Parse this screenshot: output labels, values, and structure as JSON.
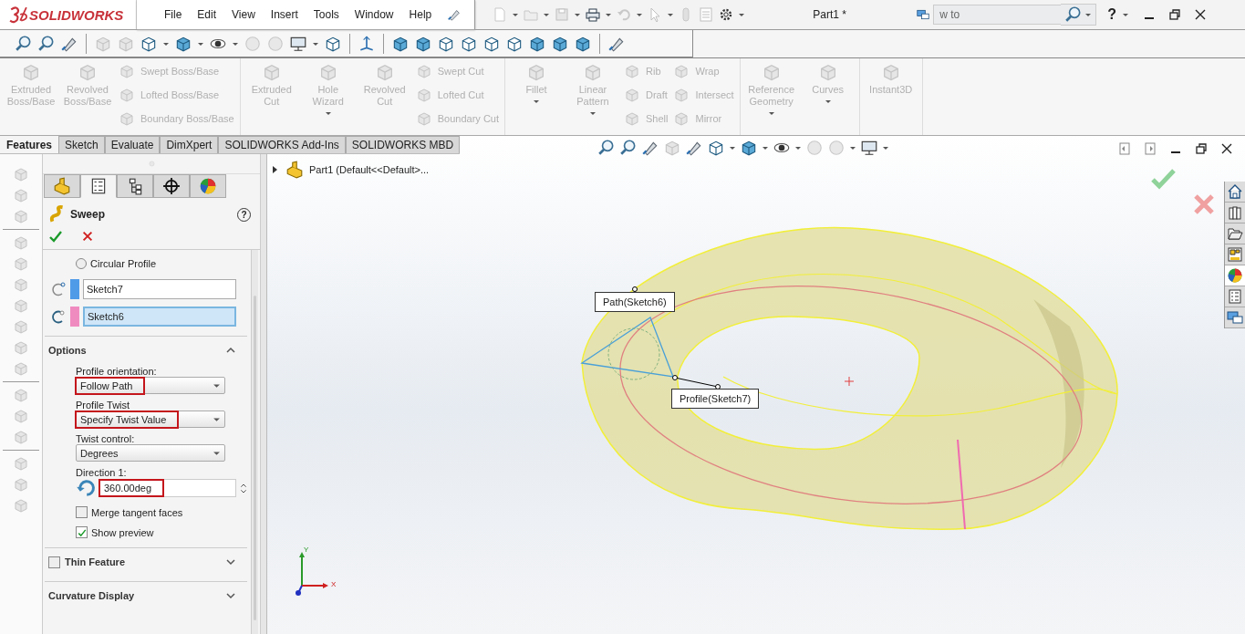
{
  "title_bar": {
    "logo": "SOLIDWORKS",
    "menu": [
      "File",
      "Edit",
      "View",
      "Insert",
      "Tools",
      "Window",
      "Help"
    ],
    "document_title": "Part1 *",
    "search": {
      "placeholder": "w to"
    },
    "help": "?"
  },
  "command_manager": {
    "groups": [
      {
        "columns": [
          {
            "kind": "large",
            "label": "Extruded Boss/Base",
            "disabled": true,
            "dropdown": false
          },
          {
            "kind": "large",
            "label": "Revolved Boss/Base",
            "disabled": true,
            "dropdown": false
          },
          {
            "kind": "stack",
            "items": [
              {
                "label": "Swept Boss/Base",
                "disabled": true
              },
              {
                "label": "Lofted Boss/Base",
                "disabled": true
              },
              {
                "label": "Boundary Boss/Base",
                "disabled": true
              }
            ]
          }
        ]
      },
      {
        "columns": [
          {
            "kind": "large",
            "label": "Extruded Cut",
            "disabled": true,
            "dropdown": false
          },
          {
            "kind": "large",
            "label": "Hole Wizard",
            "disabled": true,
            "dropdown": true
          },
          {
            "kind": "large",
            "label": "Revolved Cut",
            "disabled": true,
            "dropdown": false
          },
          {
            "kind": "stack",
            "items": [
              {
                "label": "Swept Cut",
                "disabled": true
              },
              {
                "label": "Lofted Cut",
                "disabled": true
              },
              {
                "label": "Boundary Cut",
                "disabled": true
              }
            ]
          }
        ]
      },
      {
        "columns": [
          {
            "kind": "large",
            "label": "Fillet",
            "disabled": true,
            "dropdown": true
          },
          {
            "kind": "large",
            "label": "Linear Pattern",
            "disabled": true,
            "dropdown": true
          },
          {
            "kind": "stack",
            "items": [
              {
                "label": "Rib",
                "disabled": true
              },
              {
                "label": "Draft",
                "disabled": true
              },
              {
                "label": "Shell",
                "disabled": true
              }
            ]
          },
          {
            "kind": "stack",
            "items": [
              {
                "label": "Wrap",
                "disabled": true
              },
              {
                "label": "Intersect",
                "disabled": true
              },
              {
                "label": "Mirror",
                "disabled": true
              }
            ]
          }
        ]
      },
      {
        "columns": [
          {
            "kind": "large",
            "label": "Reference Geometry",
            "disabled": true,
            "dropdown": true
          },
          {
            "kind": "large",
            "label": "Curves",
            "disabled": true,
            "dropdown": true
          }
        ]
      },
      {
        "columns": [
          {
            "kind": "large",
            "label": "Instant3D",
            "disabled": true,
            "dropdown": false
          }
        ]
      }
    ]
  },
  "tabs": [
    {
      "label": "Features",
      "selected": true
    },
    {
      "label": "Sketch",
      "selected": false
    },
    {
      "label": "Evaluate",
      "selected": false
    },
    {
      "label": "DimXpert",
      "selected": false
    },
    {
      "label": "SOLIDWORKS Add-Ins",
      "selected": false
    },
    {
      "label": "SOLIDWORKS MBD",
      "selected": false
    }
  ],
  "property_manager": {
    "tabs": [
      {
        "kind": "features",
        "selected": false
      },
      {
        "kind": "properties",
        "selected": true
      },
      {
        "kind": "configurations",
        "selected": false
      },
      {
        "kind": "dimxpert",
        "selected": false
      },
      {
        "kind": "display",
        "selected": false
      }
    ],
    "title": "Sweep",
    "help": "?",
    "profile": {
      "radio": {
        "label": "Circular Profile",
        "selected": false
      },
      "fields": [
        {
          "kind": "profile",
          "value": "Sketch7",
          "color": "#4f9be8",
          "active": false
        },
        {
          "kind": "path",
          "value": "Sketch6",
          "color": "#f08bc0",
          "active": true
        }
      ]
    },
    "options": {
      "title": "Options",
      "expanded": true,
      "controls": [
        {
          "kind": "select",
          "label": "Profile orientation:",
          "value": "Follow Path",
          "annotated": true
        },
        {
          "kind": "select",
          "label": "Profile Twist",
          "value": "Specify Twist Value",
          "annotated": true
        },
        {
          "kind": "select",
          "label": "Twist control:",
          "value": "Degrees",
          "annotated": false
        },
        {
          "kind": "spin",
          "label": "Direction 1:",
          "value": "360.00deg",
          "annotated": true
        },
        {
          "kind": "checkbox",
          "label": "Merge tangent faces",
          "checked": false
        },
        {
          "kind": "checkbox",
          "label": "Show preview",
          "checked": true
        }
      ]
    },
    "sections": [
      {
        "kind": "checkbox",
        "title": "Thin Feature",
        "checked": false,
        "expanded": false
      },
      {
        "kind": "plain",
        "title": "Curvature Display",
        "expanded": false
      }
    ]
  },
  "feature_tree": {
    "expanded": false,
    "label": "Part1  (Default<<Default>..."
  },
  "callouts": [
    {
      "label": "Path(Sketch6)"
    },
    {
      "label": "Profile(Sketch7)"
    }
  ],
  "triad_labels": [
    "Y",
    "X"
  ]
}
